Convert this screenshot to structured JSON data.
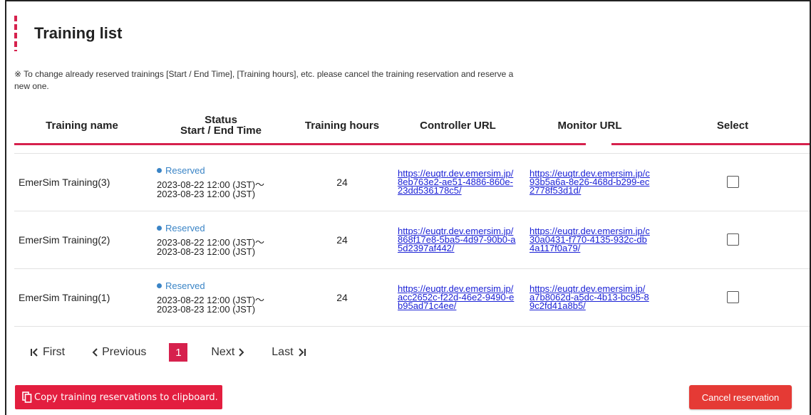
{
  "page": {
    "title": "Training list",
    "notice_mark": "※",
    "notice": "To change already reserved trainings [Start / End Time], [Training hours], etc. please cancel the training reservation and reserve a new one."
  },
  "table": {
    "headers": {
      "name": "Training name",
      "status_line1": "Status",
      "status_line2": "Start / End Time",
      "hours": "Training hours",
      "controller": "Controller URL",
      "monitor": "Monitor URL",
      "select": "Select"
    },
    "rows": [
      {
        "name": "EmerSim Training(3)",
        "status": "Reserved",
        "start": "2023-08-22 12:00 (JST)～",
        "end": "2023-08-23 12:00 (JST)",
        "hours": "24",
        "controller_url": "https://euqtr.dev.emersim.jp/8eb763e2-ae51-4886-860e-23dd536178c5/",
        "monitor_url": "https://euqtr.dev.emersim.jp/c93b5a6a-8e26-468d-b299-ec2778f53d1d/",
        "selected": false
      },
      {
        "name": "EmerSim Training(2)",
        "status": "Reserved",
        "start": "2023-08-22 12:00 (JST)～",
        "end": "2023-08-23 12:00 (JST)",
        "hours": "24",
        "controller_url": "https://euqtr.dev.emersim.jp/868f17e8-5ba5-4d97-90b0-a5d2397af442/",
        "monitor_url": "https://euqtr.dev.emersim.jp/c30a0431-f770-4135-932c-db4a117f0a79/",
        "selected": false
      },
      {
        "name": "EmerSim Training(1)",
        "status": "Reserved",
        "start": "2023-08-22 12:00 (JST)～",
        "end": "2023-08-23 12:00 (JST)",
        "hours": "24",
        "controller_url": "https://euqtr.dev.emersim.jp/acc2652c-f22d-46e2-9490-eb95ad71c4ee/",
        "monitor_url": "https://euqtr.dev.emersim.jp/a7b8062d-a5dc-4b13-bc95-89c2fd41a8b5/",
        "selected": false
      }
    ]
  },
  "pager": {
    "first": "First",
    "previous": "Previous",
    "current_page": "1",
    "next": "Next",
    "last": "Last"
  },
  "actions": {
    "copy": "Copy training reservations to clipboard.",
    "cancel": "Cancel reservation"
  },
  "colors": {
    "accent": "#d6214d",
    "status_blue": "#3a84c6",
    "button_red": "#e31e3f",
    "link": "#1c22d6"
  },
  "icons": {
    "first": "chevron-bar-left-icon",
    "previous": "chevron-left-icon",
    "next": "chevron-right-icon",
    "last": "chevron-bar-right-icon",
    "copy": "copy-icon"
  }
}
